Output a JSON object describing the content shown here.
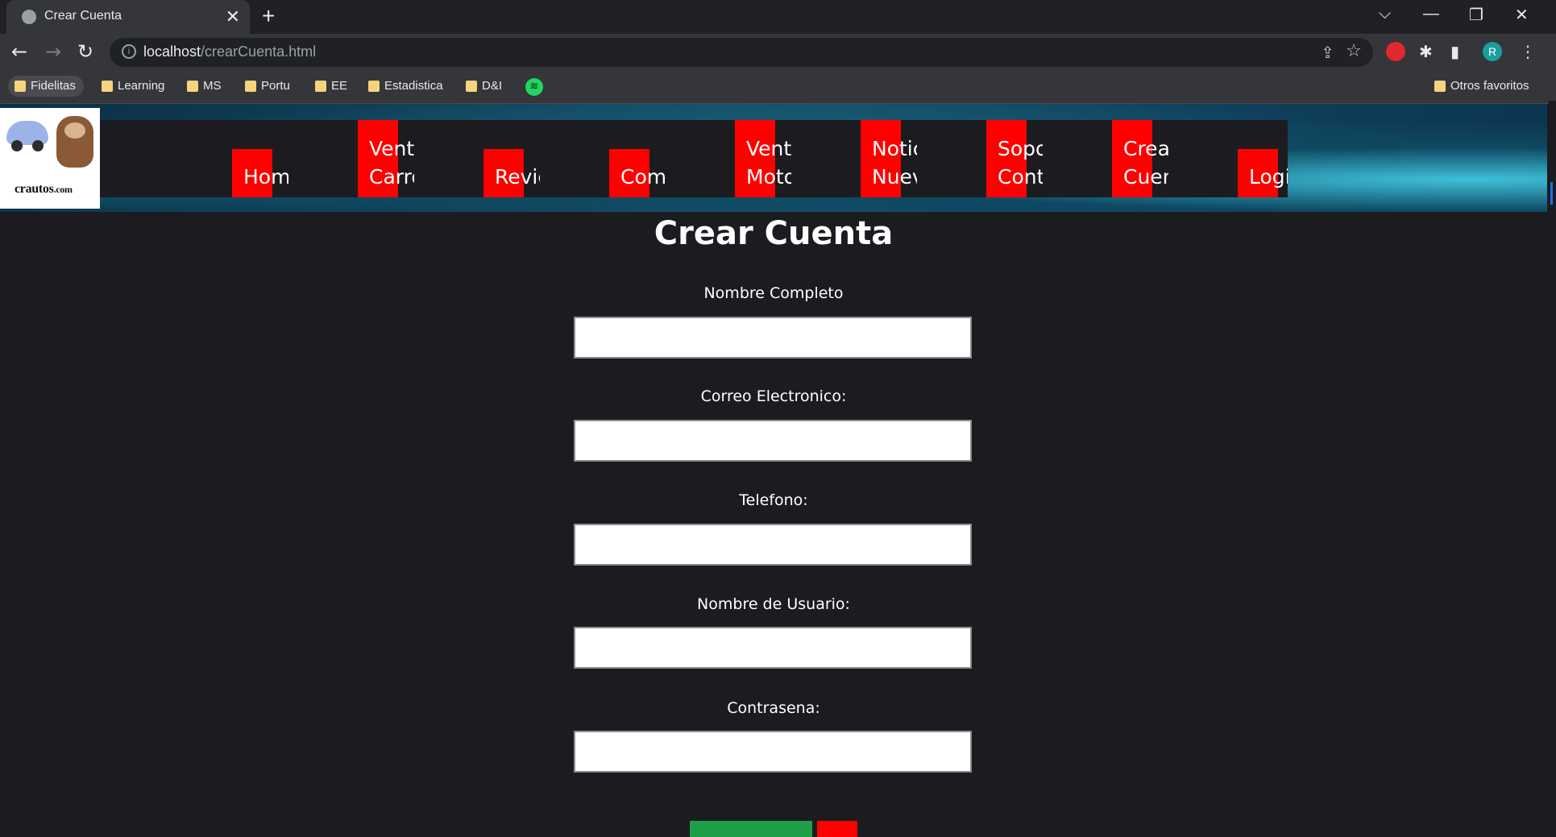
{
  "browser": {
    "tab_title": "Crear Cuenta",
    "tab_close": "✕",
    "new_tab": "+",
    "url_host": "localhost",
    "url_path": "/crearCuenta.html",
    "profile_initial": "R",
    "window_controls": {
      "dropdown": "⌵",
      "minimize": "—",
      "restore": "❐",
      "close": "✕"
    },
    "bookmarks": [
      "Fidelitas",
      "Learning",
      "MS",
      "Portu",
      "EE",
      "Estadistica",
      "D&I"
    ],
    "other_bookmarks": "Otros favoritos"
  },
  "site": {
    "logo_text": "crautos",
    "logo_suffix": ".com",
    "nav": [
      {
        "label": "Home"
      },
      {
        "label": "Venta\nCarro"
      },
      {
        "label": "Revie"
      },
      {
        "label": "Come"
      },
      {
        "label": "Venta\nMoto"
      },
      {
        "label": "Notic\nNuev"
      },
      {
        "label": "Sopor\nConta"
      },
      {
        "label": "Crear\nCuent"
      },
      {
        "label": "Login"
      }
    ]
  },
  "form": {
    "title": "Crear Cuenta",
    "fields": [
      {
        "label": "Nombre Completo",
        "value": ""
      },
      {
        "label": "Correo Electronico:",
        "value": ""
      },
      {
        "label": "Telefono:",
        "value": ""
      },
      {
        "label": "Nombre de Usuario:",
        "value": ""
      },
      {
        "label": "Contrasena:",
        "value": ""
      }
    ]
  },
  "colors": {
    "nav_accent": "#ff0000",
    "submit": "#1fa048",
    "page_bg": "#1c1c20"
  }
}
